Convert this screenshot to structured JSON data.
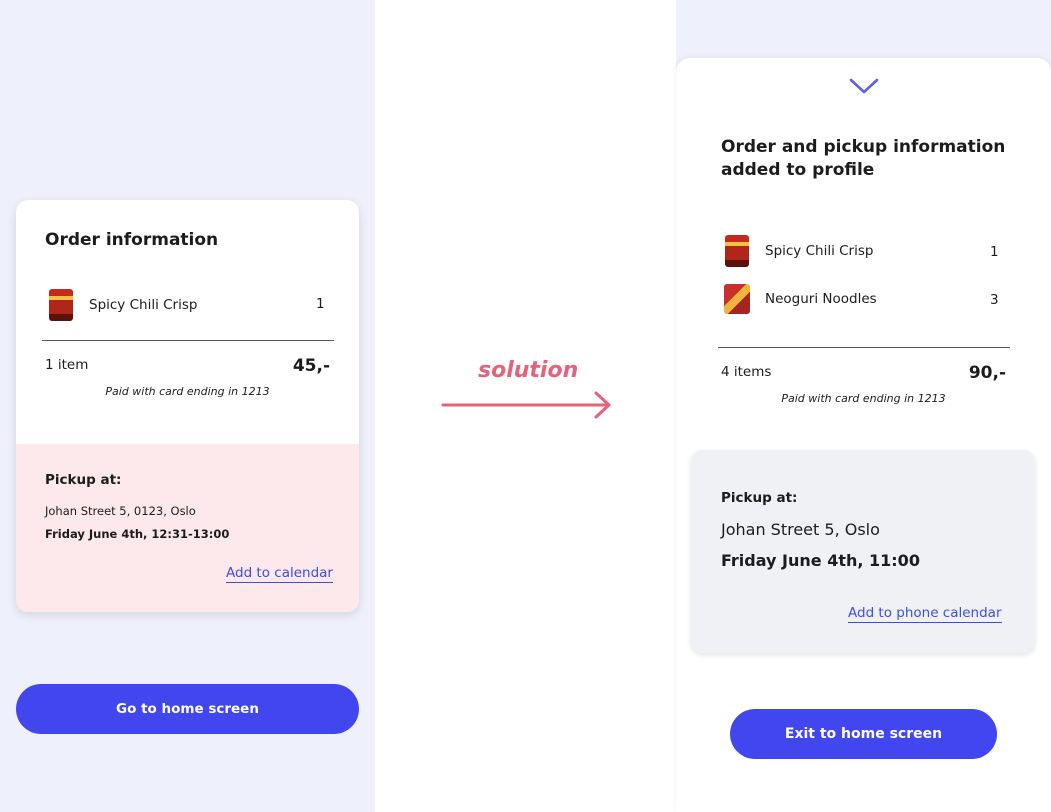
{
  "before": {
    "title": "Order information",
    "items": [
      {
        "name": "Spicy Chili Crisp",
        "qty": "1"
      }
    ],
    "count": "1 item",
    "total": "45,-",
    "paid": "Paid with card ending in 1213",
    "pickup": {
      "label": "Pickup at:",
      "address": "Johan Street 5, 0123, Oslo",
      "time": "Friday June 4th, 12:31-13:00",
      "calendar_link": "Add to calendar"
    },
    "button": "Go to home screen"
  },
  "transition": {
    "label": "solution"
  },
  "after": {
    "title": "Order and pickup information added to profile",
    "items": [
      {
        "name": "Spicy Chili Crisp",
        "qty": "1"
      },
      {
        "name": "Neoguri Noodles",
        "qty": "3"
      }
    ],
    "count": "4 items",
    "total": "90,-",
    "paid": "Paid with card ending in 1213",
    "pickup": {
      "label": "Pickup at:",
      "address": "Johan Street 5, Oslo",
      "time": "Friday June 4th, 11:00",
      "calendar_link": "Add to phone calendar"
    },
    "button": "Exit to home screen"
  },
  "icons": {
    "collapse": "chevron-down-icon",
    "transition": "arrow-right-icon"
  },
  "colors": {
    "accent": "#4146ef",
    "link": "#3d4de3",
    "highlight": "#e8607a",
    "panel_bg": "#eef0fb",
    "pickup_bg_before": "#fde8eb",
    "pickup_bg_after": "#f0f1f5"
  }
}
